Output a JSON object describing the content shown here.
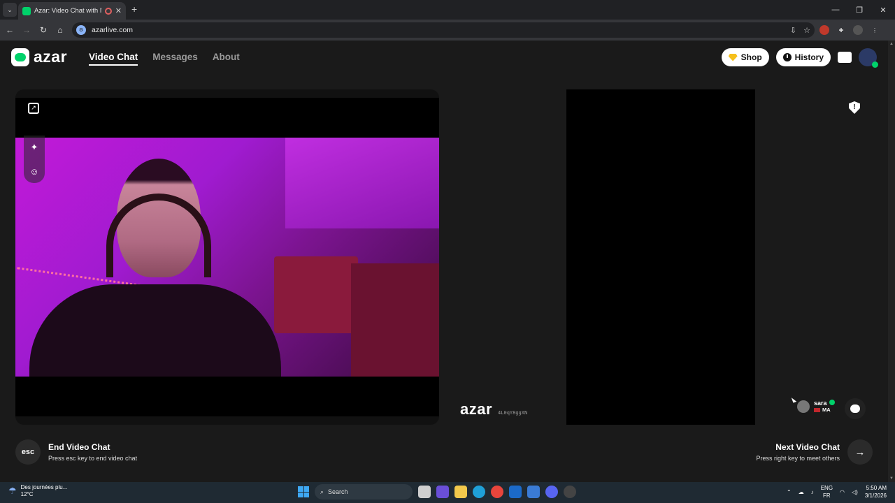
{
  "browser": {
    "tab_title": "Azar: Video Chat with New",
    "url": "azarlive.com",
    "new_tab_label": "+"
  },
  "header": {
    "logo_text": "azar",
    "nav": [
      "Video Chat",
      "Messages",
      "About"
    ],
    "shop_label": "Shop",
    "history_label": "History"
  },
  "remote": {
    "watermark_logo": "azar",
    "watermark_code": "4L0qY8ggXN",
    "peer_name": "sara",
    "peer_country": "MA"
  },
  "footer": {
    "esc_key": "esc",
    "end_title": "End Video Chat",
    "end_sub": "Press esc key to end video chat",
    "next_title": "Next Video Chat",
    "next_sub": "Press right key to meet others"
  },
  "taskbar": {
    "weather_text": "Des journées plu...",
    "temperature": "12°C",
    "search_label": "Search",
    "lang_top": "ENG",
    "lang_bottom": "FR",
    "time": "5:50 AM",
    "date": "3/1/2026"
  },
  "colors": {
    "brand_green": "#00d26a",
    "page_bg": "#1a1a1a",
    "shop_gem": "#f6c01b"
  },
  "icons": [
    "expand-icon",
    "magic-wand-icon",
    "face-filter-icon",
    "report-icon",
    "chat-icon",
    "arrow-right-icon",
    "shop-gem-icon",
    "clock-icon",
    "inbox-icon"
  ]
}
